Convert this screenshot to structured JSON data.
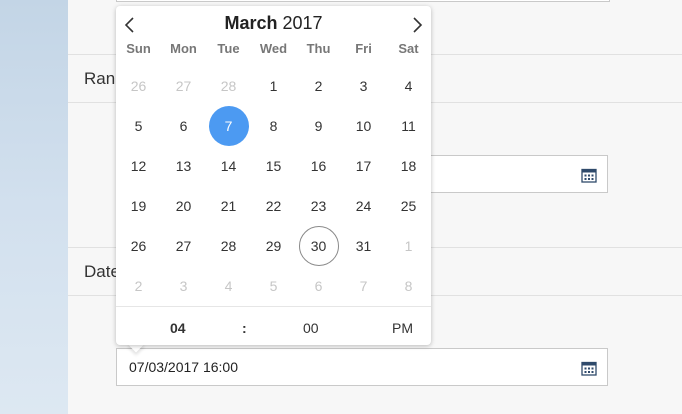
{
  "sections": {
    "range_label": "Ran",
    "date_label": "Date"
  },
  "fields": {
    "date_time_value": "07/03/2017 16:00",
    "range_value": ""
  },
  "calendar": {
    "month": "March",
    "year": "2017",
    "weekdays": [
      "Sun",
      "Mon",
      "Tue",
      "Wed",
      "Thu",
      "Fri",
      "Sat"
    ],
    "weeks": [
      [
        "26",
        "27",
        "28",
        "1",
        "2",
        "3",
        "4"
      ],
      [
        "5",
        "6",
        "7",
        "8",
        "9",
        "10",
        "11"
      ],
      [
        "12",
        "13",
        "14",
        "15",
        "16",
        "17",
        "18"
      ],
      [
        "19",
        "20",
        "21",
        "22",
        "23",
        "24",
        "25"
      ],
      [
        "26",
        "27",
        "28",
        "29",
        "30",
        "31",
        "1"
      ],
      [
        "2",
        "3",
        "4",
        "5",
        "6",
        "7",
        "8"
      ]
    ],
    "selected_day": "7",
    "today_day": "30",
    "time": {
      "hour": "04",
      "separator": ":",
      "minute": "00",
      "ampm": "PM"
    }
  },
  "colors": {
    "selected": "#4c9af2",
    "other_month_text": "#c6c6c6"
  },
  "icons": {
    "prev": "chevron-left-icon",
    "next": "chevron-right-icon",
    "calendar": "calendar-icon"
  }
}
